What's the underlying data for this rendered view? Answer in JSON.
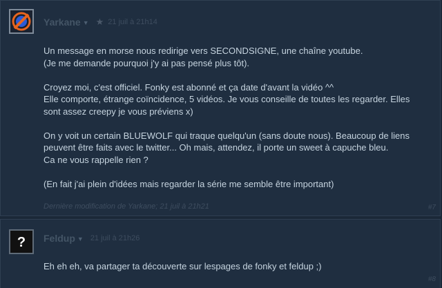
{
  "comments": [
    {
      "author": "Yarkane",
      "time": "21 juil à 21h14",
      "body": "Un message en morse nous redirige vers SECONDSIGNE, une chaîne youtube.\n(Je me demande pourquoi j'y ai pas pensé plus tôt).\n\nCroyez moi, c'est officiel. Fonky est abonné et ça date d'avant la vidéo ^^\nElle comporte, étrange coïncidence, 5 vidéos. Je vous conseille de toutes les regarder. Elles sont assez creepy je vous préviens x)\n\nOn y voit un certain BLUEWOLF qui traque quelqu'un (sans doute nous). Beaucoup de liens peuvent être faits avec le twitter... Oh mais, attendez, il porte un sweet à capuche bleu.\nCa ne vous rappelle rien ?\n\n(En fait j'ai plein d'idées mais regarder la série me semble être important)",
      "edited": "Dernière modification de Yarkane; 21 juil à 21h21",
      "number": "#7"
    },
    {
      "author": "Feldup",
      "avatar_glyph": "?",
      "time": "21 juil à 21h26",
      "body": "Eh eh eh, va partager ta découverte sur lespages de fonky et feldup ;)",
      "number": "#8"
    }
  ]
}
